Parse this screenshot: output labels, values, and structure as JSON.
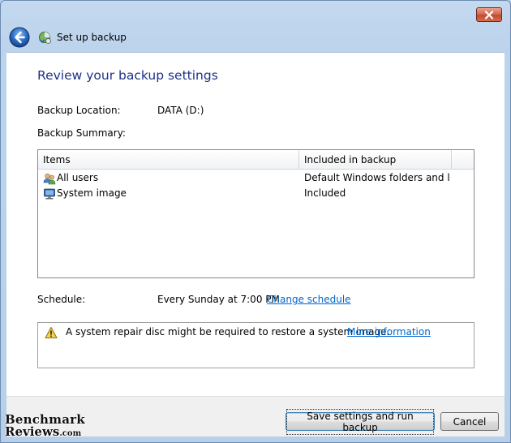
{
  "window": {
    "title": "Set up backup"
  },
  "page": {
    "heading": "Review your backup settings",
    "backup_location_label": "Backup Location:",
    "backup_location_value": "DATA (D:)",
    "backup_summary_label": "Backup Summary:",
    "summary_table": {
      "columns": [
        "Items",
        "Included in backup"
      ],
      "rows": [
        {
          "item": "All users",
          "included": "Default Windows folders and lo...",
          "icon": "users-icon"
        },
        {
          "item": "System image",
          "included": "Included",
          "icon": "computer-icon"
        }
      ]
    },
    "schedule_label": "Schedule:",
    "schedule_value": "Every Sunday at 7:00 PM",
    "change_schedule_link": "Change schedule",
    "warning_text": "A system repair disc might be required to restore a system image.",
    "more_information_link": "More information"
  },
  "buttons": {
    "save_run": "Save settings and run backup",
    "cancel": "Cancel"
  },
  "watermark": {
    "line1": "Benchmark",
    "line2": "Reviews",
    "suffix": ".com"
  },
  "colors": {
    "heading": "#1e3287",
    "link": "#0066cc",
    "close_button": "#c24a2f",
    "frame": "#bcd3ec"
  }
}
